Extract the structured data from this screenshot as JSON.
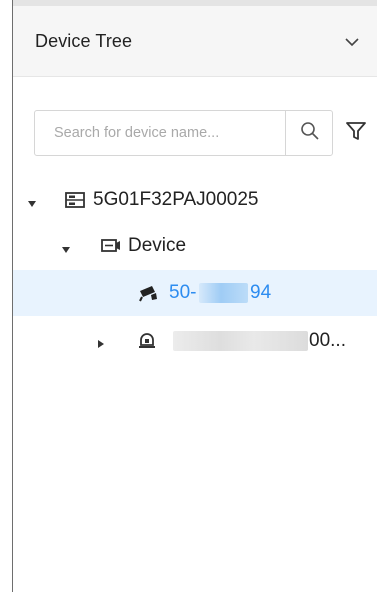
{
  "panel": {
    "title": "Device Tree",
    "collapse_icon": "chevron-down-icon"
  },
  "search": {
    "placeholder": "Search for device name...",
    "value": "",
    "search_icon": "search-icon",
    "filter_icon": "filter-icon"
  },
  "tree": {
    "root": {
      "label": "5G01F32PAJ00025",
      "expanded": true,
      "icon": "server-icon"
    },
    "group": {
      "label": "Device",
      "expanded": true,
      "icon": "device-icon"
    },
    "selected_device": {
      "label_prefix": "50-",
      "label_suffix": "94",
      "icon": "camera-icon",
      "selected": true
    },
    "other_device": {
      "label_suffix": "00...",
      "expanded": false,
      "icon": "alarm-device-icon"
    }
  },
  "colors": {
    "accent": "#2d8cf0",
    "selected_row_bg": "#e8f3fe",
    "header_bg": "#f6f6f6",
    "text": "#222222"
  }
}
